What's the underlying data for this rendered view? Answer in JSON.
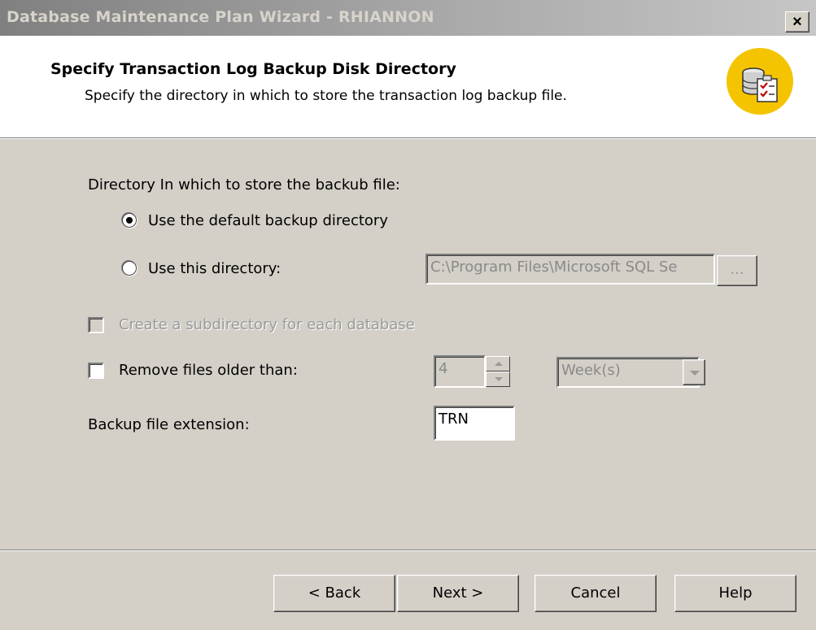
{
  "window": {
    "title": "Database Maintenance Plan Wizard - RHIANNON",
    "close_label": "×"
  },
  "header": {
    "title": "Specify Transaction Log Backup Disk Directory",
    "subtitle": "Specify the directory in which to store the transaction log backup file.",
    "icon": "database-checklist-icon"
  },
  "body": {
    "directory_label": "Directory In which to store the backub file:",
    "radio_default": {
      "label": "Use the default backup directory",
      "selected": true
    },
    "radio_custom": {
      "label": "Use this directory:",
      "selected": false,
      "path": "C:\\Program Files\\Microsoft SQL Se",
      "browse_label": "..."
    },
    "subdir_checkbox": {
      "label": "Create a subdirectory for each database",
      "checked": false,
      "enabled": false
    },
    "remove_checkbox": {
      "label": "Remove files older than:",
      "checked": false
    },
    "remove_value": "4",
    "remove_unit": "Week(s)",
    "extension_label": "Backup file extension:",
    "extension_value": "TRN"
  },
  "footer": {
    "back": "< Back",
    "next": "Next >",
    "cancel": "Cancel",
    "help": "Help"
  }
}
